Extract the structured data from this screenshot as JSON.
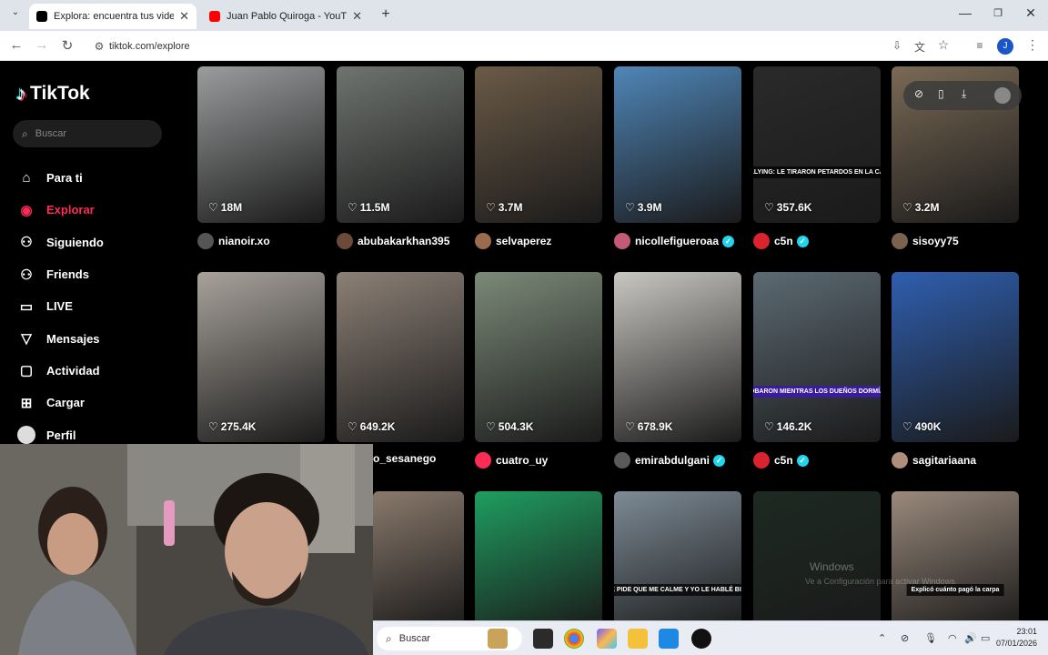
{
  "browser": {
    "tabs": [
      {
        "title": "Explora: encuentra tus videos fa",
        "color": "#000000"
      },
      {
        "title": "Juan Pablo Quiroga - YouTube",
        "color": "#ff0000"
      }
    ],
    "url": "tiktok.com/explore",
    "profile_initial": "J"
  },
  "tiktok": {
    "logo": "TikTok",
    "search_placeholder": "Buscar",
    "nav": [
      {
        "label": "Para ti",
        "icon": "home-icon"
      },
      {
        "label": "Explorar",
        "icon": "compass-icon",
        "active": true
      },
      {
        "label": "Siguiendo",
        "icon": "following-icon"
      },
      {
        "label": "Friends",
        "icon": "friends-icon"
      },
      {
        "label": "LIVE",
        "icon": "live-icon"
      },
      {
        "label": "Mensajes",
        "icon": "messages-icon"
      },
      {
        "label": "Actividad",
        "icon": "activity-icon"
      },
      {
        "label": "Cargar",
        "icon": "upload-icon"
      },
      {
        "label": "Perfil",
        "icon": "profile-icon"
      }
    ],
    "videos": [
      {
        "likes": "18M",
        "author": "nianoir.xo",
        "verified": false,
        "bg": "#9a9c9d"
      },
      {
        "likes": "11.5M",
        "author": "abubakarkhan395",
        "verified": false,
        "bg": "#6f7470"
      },
      {
        "likes": "3.7M",
        "author": "selvaperez",
        "verified": false,
        "bg": "#6b5a47"
      },
      {
        "likes": "3.9M",
        "author": "nicollefigueroaa",
        "verified": true,
        "bg": "#4f86b8"
      },
      {
        "likes": "357.6K",
        "author": "c5n",
        "verified": true,
        "bg": "#2a2a2a",
        "overlay": "BULLYING: LE TIRARON PETARDOS EN LA CASA"
      },
      {
        "likes": "3.2M",
        "author": "sisoyy75",
        "verified": false,
        "bg": "#7a6a55"
      },
      {
        "likes": "275.4K",
        "author": "",
        "verified": false,
        "bg": "#a8a29b"
      },
      {
        "likes": "649.2K",
        "author": "o_sesanego",
        "verified": false,
        "bg": "#8c8076"
      },
      {
        "likes": "504.3K",
        "author": "cuatro_uy",
        "verified": false,
        "bg": "#7b8a78"
      },
      {
        "likes": "678.9K",
        "author": "emirabdulgani",
        "verified": true,
        "bg": "#c9c7c2"
      },
      {
        "likes": "146.2K",
        "author": "c5n",
        "verified": true,
        "bg": "#5c6a73",
        "overlay": "ROBARON MIENTRAS LOS DUEÑOS DORMÍAN"
      },
      {
        "likes": "490K",
        "author": "sagitariaana",
        "verified": false,
        "bg": "#2f5fb0"
      },
      {
        "likes": "",
        "author": "",
        "verified": false,
        "bg": "#8a7a6c"
      },
      {
        "likes": "",
        "author": "",
        "verified": false,
        "bg": "#1f9e60"
      },
      {
        "likes": "",
        "author": "",
        "verified": false,
        "bg": "#7d8b96",
        "overlay": "ME PIDE QUE ME CALME Y YO LE HABLÉ BIEN"
      },
      {
        "likes": "",
        "author": "",
        "verified": false,
        "bg": "#1d2a22"
      },
      {
        "likes": "",
        "author": "",
        "verified": false,
        "bg": "#9a8a7c",
        "overlay": "Explicó cuánto pagó la carpa"
      }
    ],
    "watermark": "Windows",
    "watermark_sub": "Ve a Configuración para activar Windows."
  },
  "taskbar": {
    "search_placeholder": "Buscar",
    "time": "23:01",
    "date": "07/01/2026"
  }
}
